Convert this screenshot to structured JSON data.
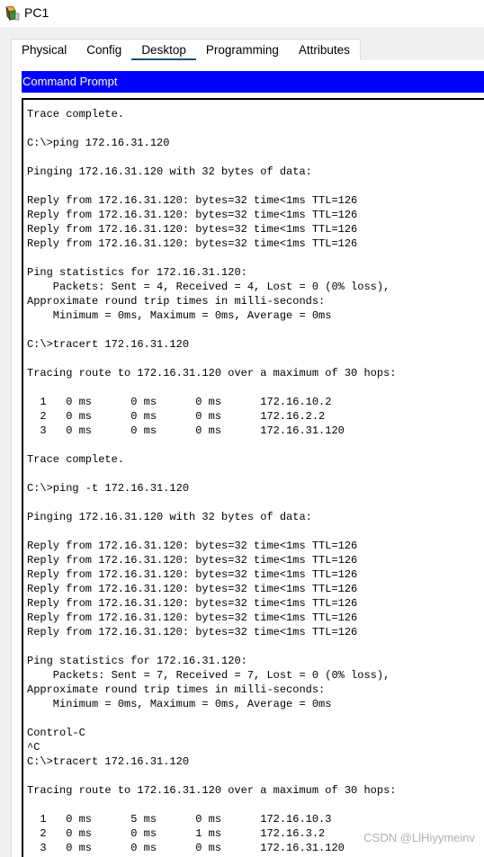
{
  "window": {
    "title": "PC1",
    "icon": "packet-tracer-pc-icon"
  },
  "tabs": [
    {
      "label": "Physical",
      "active": false
    },
    {
      "label": "Config",
      "active": false
    },
    {
      "label": "Desktop",
      "active": true
    },
    {
      "label": "Programming",
      "active": false
    },
    {
      "label": "Attributes",
      "active": false
    }
  ],
  "command_prompt": {
    "title": "Command Prompt",
    "output": "Trace complete.\n\nC:\\>ping 172.16.31.120\n\nPinging 172.16.31.120 with 32 bytes of data:\n\nReply from 172.16.31.120: bytes=32 time<1ms TTL=126\nReply from 172.16.31.120: bytes=32 time<1ms TTL=126\nReply from 172.16.31.120: bytes=32 time<1ms TTL=126\nReply from 172.16.31.120: bytes=32 time<1ms TTL=126\n\nPing statistics for 172.16.31.120:\n    Packets: Sent = 4, Received = 4, Lost = 0 (0% loss),\nApproximate round trip times in milli-seconds:\n    Minimum = 0ms, Maximum = 0ms, Average = 0ms\n\nC:\\>tracert 172.16.31.120\n\nTracing route to 172.16.31.120 over a maximum of 30 hops:\n\n  1   0 ms      0 ms      0 ms      172.16.10.2\n  2   0 ms      0 ms      0 ms      172.16.2.2\n  3   0 ms      0 ms      0 ms      172.16.31.120\n\nTrace complete.\n\nC:\\>ping -t 172.16.31.120\n\nPinging 172.16.31.120 with 32 bytes of data:\n\nReply from 172.16.31.120: bytes=32 time<1ms TTL=126\nReply from 172.16.31.120: bytes=32 time<1ms TTL=126\nReply from 172.16.31.120: bytes=32 time<1ms TTL=126\nReply from 172.16.31.120: bytes=32 time<1ms TTL=126\nReply from 172.16.31.120: bytes=32 time<1ms TTL=126\nReply from 172.16.31.120: bytes=32 time<1ms TTL=126\nReply from 172.16.31.120: bytes=32 time<1ms TTL=126\n\nPing statistics for 172.16.31.120:\n    Packets: Sent = 7, Received = 7, Lost = 0 (0% loss),\nApproximate round trip times in milli-seconds:\n    Minimum = 0ms, Maximum = 0ms, Average = 0ms\n\nControl-C\n^C\nC:\\>tracert 172.16.31.120\n\nTracing route to 172.16.31.120 over a maximum of 30 hops:\n\n  1   0 ms      5 ms      0 ms      172.16.10.3\n  2   0 ms      0 ms      1 ms      172.16.3.2\n  3   0 ms      0 ms      0 ms      172.16.31.120"
  },
  "watermark": "CSDN @LlHiyymeinv",
  "colors": {
    "cmd_title_bg": "#0000ff",
    "cmd_title_fg": "#ffffff",
    "window_bg": "#f0f0f0",
    "active_tab_underline": "#1f4e79"
  }
}
